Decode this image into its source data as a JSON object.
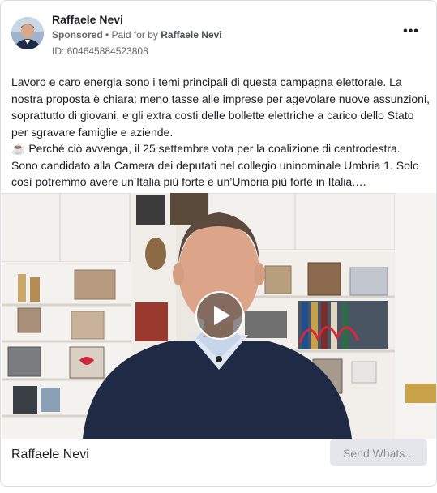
{
  "ad": {
    "page_name": "Raffaele Nevi",
    "sponsored_label": "Sponsored",
    "separator": " • ",
    "paid_for_prefix": "Paid for by ",
    "paid_for_name": "Raffaele Nevi",
    "ad_id": "ID: 604645884523808",
    "more_icon": "•••"
  },
  "body": {
    "paragraph_1": "Lavoro e caro energia sono i temi principali di questa campagna elettorale. La nostra proposta è chiara: meno tasse alle imprese per agevolare nuove assunzioni, soprattutto di giovani, e gli extra costi delle bollette elettriche a carico dello Stato per sgravare famiglie e aziende.",
    "paragraph_2_emoji": "☕",
    "paragraph_2": " Perché ciò avvenga, il 25 settembre vota per la coalizione di centrodestra. Sono candidato alla Camera dei deputati nel collegio uninominale Umbria 1. Solo così potremmo avere un’Italia più forte e un’Umbria più forte in Italia.…"
  },
  "footer": {
    "name": "Raffaele Nevi",
    "cta_label": "Send Whats..."
  },
  "icons": {
    "avatar": "avatar",
    "more": "more-options-icon",
    "play": "play-icon"
  }
}
